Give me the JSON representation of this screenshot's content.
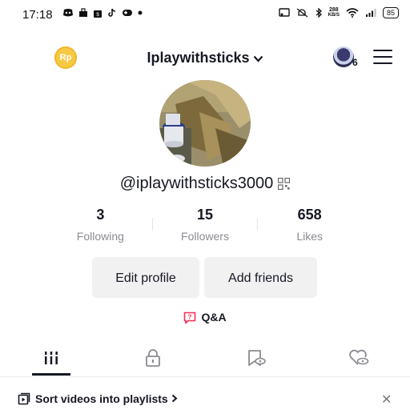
{
  "status_bar": {
    "time": "17:18",
    "net_speed_value": "288",
    "net_speed_unit": "KB/S",
    "battery": "85"
  },
  "header": {
    "coin_label": "Rp",
    "username": "Iplaywithsticks",
    "notification_count": "6"
  },
  "profile": {
    "handle": "@iplaywithsticks3000"
  },
  "stats": [
    {
      "value": "3",
      "label": "Following"
    },
    {
      "value": "15",
      "label": "Followers"
    },
    {
      "value": "658",
      "label": "Likes"
    }
  ],
  "actions": {
    "edit_profile": "Edit profile",
    "add_friends": "Add friends"
  },
  "qa": {
    "label": "Q&A"
  },
  "tabs": [
    {
      "icon": "videos-grid-icon"
    },
    {
      "icon": "lock-icon"
    },
    {
      "icon": "bookmark-eye-icon"
    },
    {
      "icon": "heart-eye-icon"
    }
  ],
  "playlist_banner": {
    "text": "Sort videos into playlists"
  },
  "colors": {
    "accent": "#fe2c55",
    "text": "#161823",
    "muted": "#8a8b91",
    "button_bg": "#f1f1f2"
  }
}
